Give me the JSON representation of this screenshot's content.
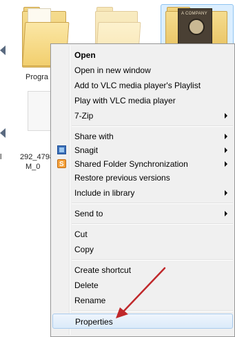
{
  "desktop": {
    "items": [
      {
        "label": "Progra"
      },
      {
        "label": "292_4798"
      },
      {
        "label": "M_0"
      },
      {
        "label": "l"
      }
    ],
    "thumbnail_title": "A COMPANY"
  },
  "context_menu": {
    "open": "Open",
    "open_new_window": "Open in new window",
    "add_vlc_playlist": "Add to VLC media player's Playlist",
    "play_vlc": "Play with VLC media player",
    "zip": "7-Zip",
    "share_with": "Share with",
    "snagit": "Snagit",
    "shared_folder_sync": "Shared Folder Synchronization",
    "restore_versions": "Restore previous versions",
    "include_library": "Include in library",
    "send_to": "Send to",
    "cut": "Cut",
    "copy": "Copy",
    "create_shortcut": "Create shortcut",
    "delete": "Delete",
    "rename": "Rename",
    "properties": "Properties"
  },
  "icons": {
    "snagit": "snagit-icon",
    "sync": "shared-folder-sync-icon",
    "submenu": "chevron-right-icon"
  },
  "colors": {
    "menu_bg": "#f0f0f0",
    "highlight": "#dbeaf9",
    "annotation_arrow": "#c0282b"
  }
}
